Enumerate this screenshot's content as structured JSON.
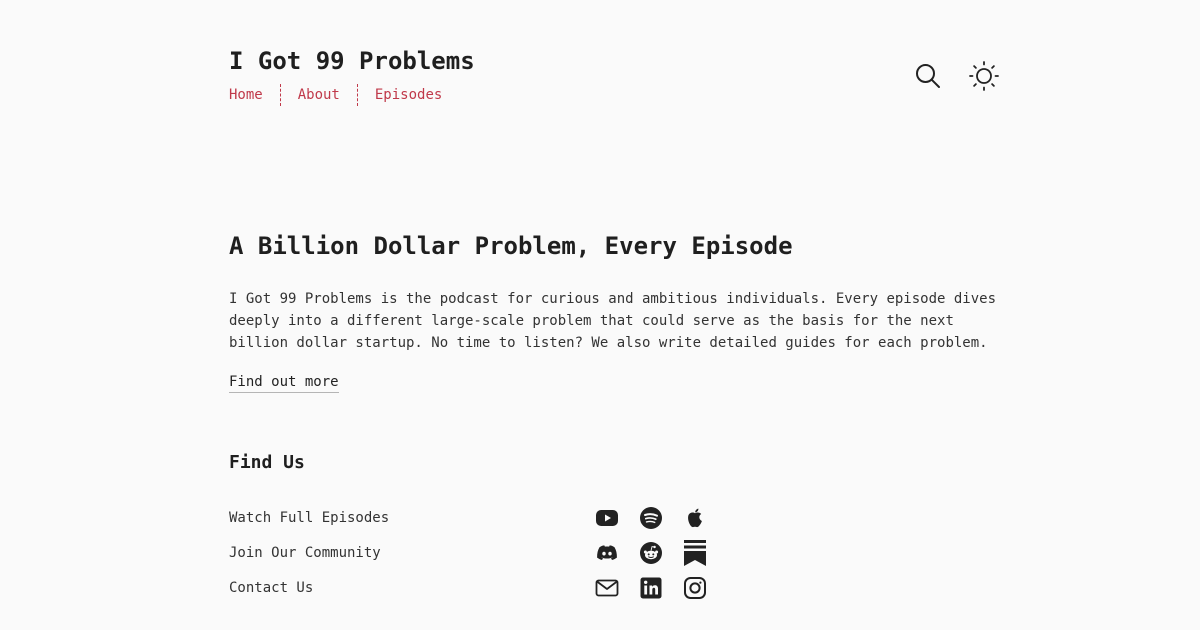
{
  "site": {
    "title": "I Got 99 Problems"
  },
  "nav": {
    "items": [
      {
        "label": "Home"
      },
      {
        "label": "About"
      },
      {
        "label": "Episodes"
      }
    ]
  },
  "header_icons": [
    "search-icon",
    "sun-icon"
  ],
  "hero": {
    "heading": "A Billion Dollar Problem, Every Episode",
    "description": "I Got 99 Problems is the podcast for curious and ambitious individuals. Every episode dives deeply into a different large-scale problem that could serve as the basis for the next billion dollar startup. No time to listen? We also write detailed guides for each problem.",
    "link_label": "Find out more"
  },
  "find_us": {
    "heading": "Find Us",
    "rows": [
      {
        "label": "Watch Full Episodes",
        "icons": [
          "youtube-icon",
          "spotify-icon",
          "apple-icon"
        ]
      },
      {
        "label": "Join Our Community",
        "icons": [
          "discord-icon",
          "reddit-icon",
          "substack-icon"
        ]
      },
      {
        "label": "Contact Us",
        "icons": [
          "mail-icon",
          "linkedin-icon",
          "instagram-icon"
        ]
      }
    ]
  },
  "colors": {
    "background": "#fafafa",
    "text": "#222222",
    "accent": "#c0394a"
  }
}
